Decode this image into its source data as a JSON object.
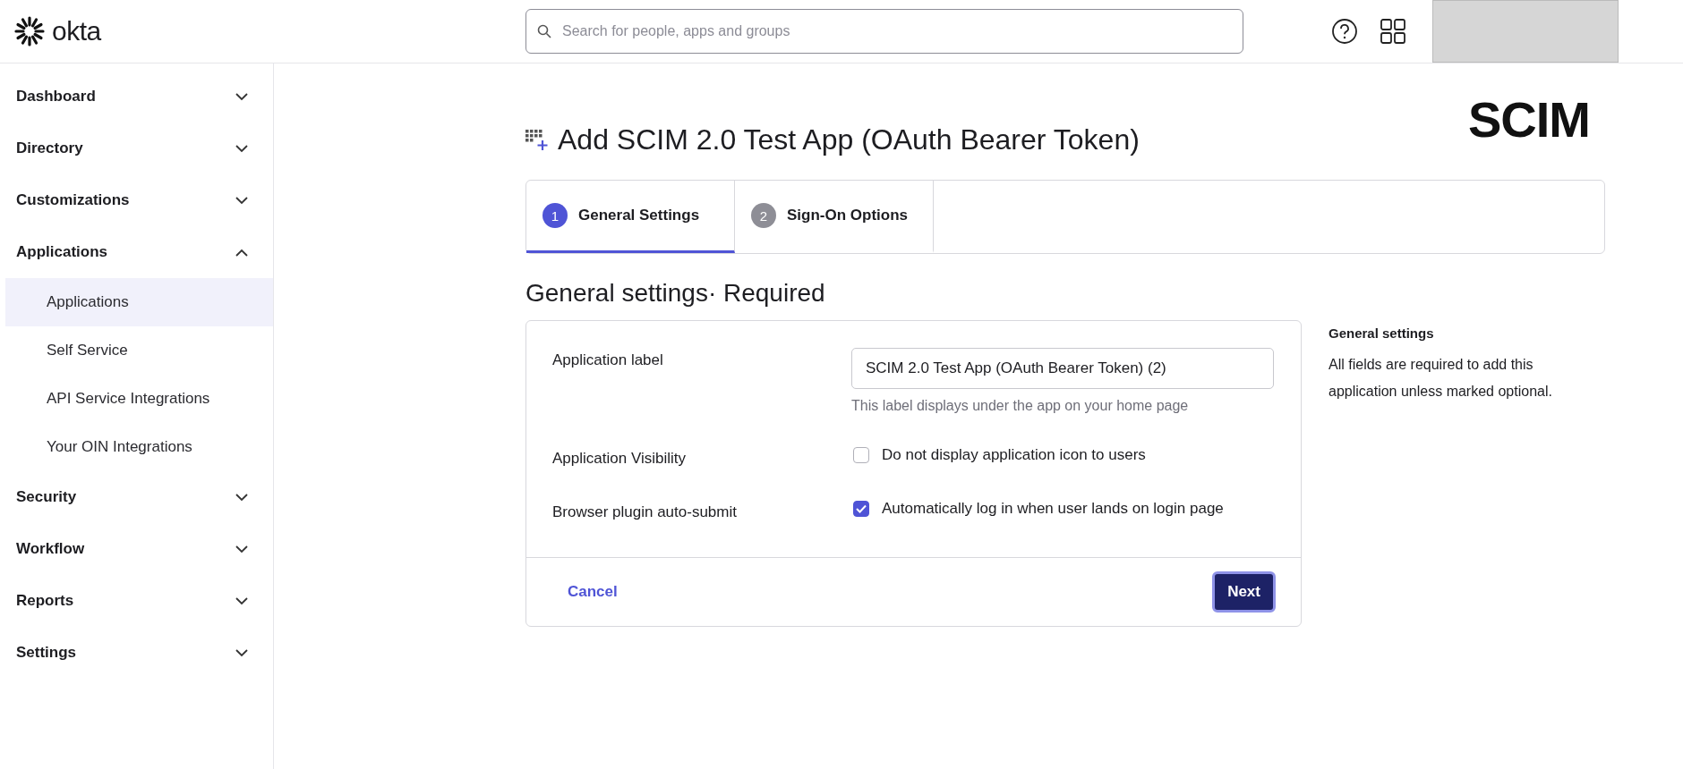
{
  "header": {
    "logo_text": "okta",
    "search": {
      "placeholder": "Search for people, apps and groups"
    }
  },
  "sidebar": {
    "items": [
      {
        "label": "Dashboard",
        "expanded": false
      },
      {
        "label": "Directory",
        "expanded": false
      },
      {
        "label": "Customizations",
        "expanded": false
      },
      {
        "label": "Applications",
        "expanded": true,
        "children": [
          {
            "label": "Applications",
            "selected": true
          },
          {
            "label": "Self Service",
            "selected": false
          },
          {
            "label": "API Service Integrations",
            "selected": false
          },
          {
            "label": "Your OIN Integrations",
            "selected": false
          }
        ]
      },
      {
        "label": "Security",
        "expanded": false
      },
      {
        "label": "Workflow",
        "expanded": false
      },
      {
        "label": "Reports",
        "expanded": false
      },
      {
        "label": "Settings",
        "expanded": false
      }
    ]
  },
  "page": {
    "title": "Add SCIM 2.0 Test App (OAuth Bearer Token)",
    "brand_logo": "SCIM",
    "tabs": [
      {
        "number": "1",
        "label": "General Settings",
        "selected": true
      },
      {
        "number": "2",
        "label": "Sign-On Options",
        "selected": false
      }
    ],
    "section_title": "General settings· Required",
    "form": {
      "rows": [
        {
          "kind": "text",
          "label": "Application label",
          "value": "SCIM 2.0 Test App (OAuth Bearer Token) (2)",
          "help": "This label displays under the app on your home page"
        },
        {
          "kind": "checkbox",
          "label": "Application Visibility",
          "option": "Do not display application icon to users",
          "checked": false
        },
        {
          "kind": "checkbox",
          "label": "Browser plugin auto-submit",
          "option": "Automatically log in when user lands on login page",
          "checked": true
        }
      ],
      "cancel": "Cancel",
      "next": "Next"
    },
    "aside": {
      "title": "General settings",
      "text": "All fields are required to add this application unless marked optional."
    }
  }
}
